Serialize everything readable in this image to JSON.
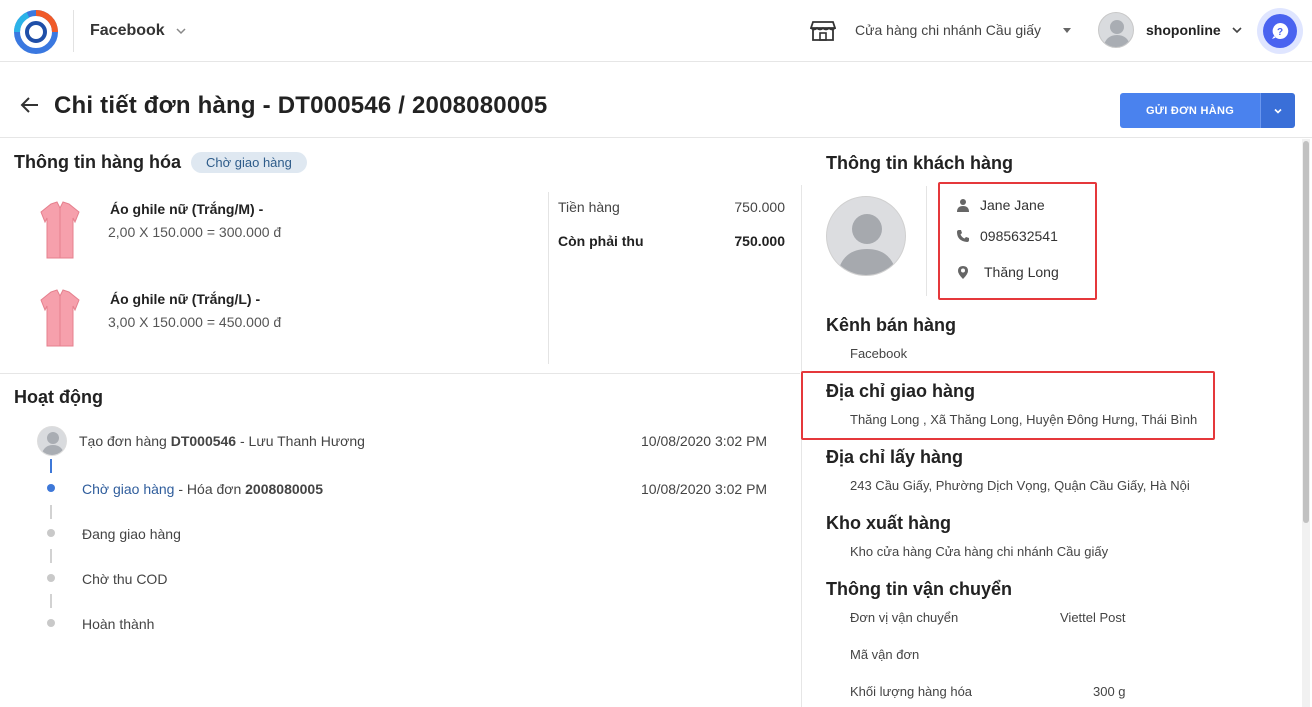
{
  "header": {
    "channel": "Facebook",
    "store_name": "Cửa hàng chi nhánh Cầu giấy",
    "username": "shoponline",
    "logo_icon": "app-logo-icon",
    "store_icon": "store-icon",
    "help_icon": "chat-help-icon"
  },
  "page": {
    "title": "Chi tiết đơn hàng - DT000546 / 2008080005",
    "send_button": "GỬI ĐƠN HÀNG"
  },
  "goods": {
    "title": "Thông tin hàng hóa",
    "status": "Chờ giao hàng",
    "items": [
      {
        "name": "Áo ghile nữ (Trắng/M) -",
        "qty_line": "2,00 X 150.000 = 300.000 đ"
      },
      {
        "name": "Áo ghile nữ (Trắng/L) -",
        "qty_line": "3,00 X 150.000 = 450.000 đ"
      }
    ],
    "summary": {
      "subtotal_label": "Tiền hàng",
      "subtotal_value": "750.000",
      "due_label": "Còn phải thu",
      "due_value": "750.000"
    }
  },
  "activity": {
    "title": "Hoạt động",
    "steps": [
      {
        "prefix": "Tạo đơn hàng ",
        "code": "DT000546",
        "suffix": " - Lưu Thanh Hương",
        "time": "10/08/2020 3:02 PM"
      },
      {
        "prefix": "Chờ giao hàng",
        "middle": " - Hóa đơn ",
        "code": "2008080005",
        "time": "10/08/2020 3:02 PM"
      },
      {
        "label": "Đang giao hàng"
      },
      {
        "label": "Chờ thu COD"
      },
      {
        "label": "Hoàn thành"
      }
    ]
  },
  "customer": {
    "title": "Thông tin khách hàng",
    "name": "Jane Jane",
    "phone": "0985632541",
    "location": "Thăng Long"
  },
  "sales_channel": {
    "title": "Kênh bán hàng",
    "value": "Facebook"
  },
  "shipping_address": {
    "title": "Địa chỉ giao hàng",
    "value": "Thăng Long , Xã Thăng Long, Huyện Đông Hưng, Thái Bình"
  },
  "pickup_address": {
    "title": "Địa chỉ lấy hàng",
    "value": "243 Cầu Giấy, Phường Dịch Vọng, Quận Cầu Giấy, Hà Nội"
  },
  "warehouse": {
    "title": "Kho xuất hàng",
    "value": "Kho cửa hàng Cửa hàng chi nhánh Cầu giấy"
  },
  "shipping": {
    "title": "Thông tin vận chuyển",
    "carrier_label": "Đơn vị vận chuyển",
    "carrier_value": "Viettel Post",
    "tracking_label": "Mã vận đơn",
    "tracking_value": "",
    "weight_label": "Khối lượng hàng hóa",
    "weight_value": "300 g"
  },
  "colors": {
    "accent": "#4a82ee",
    "highlight_border": "#e5383b",
    "status_pill_bg": "#dfe8f1"
  }
}
